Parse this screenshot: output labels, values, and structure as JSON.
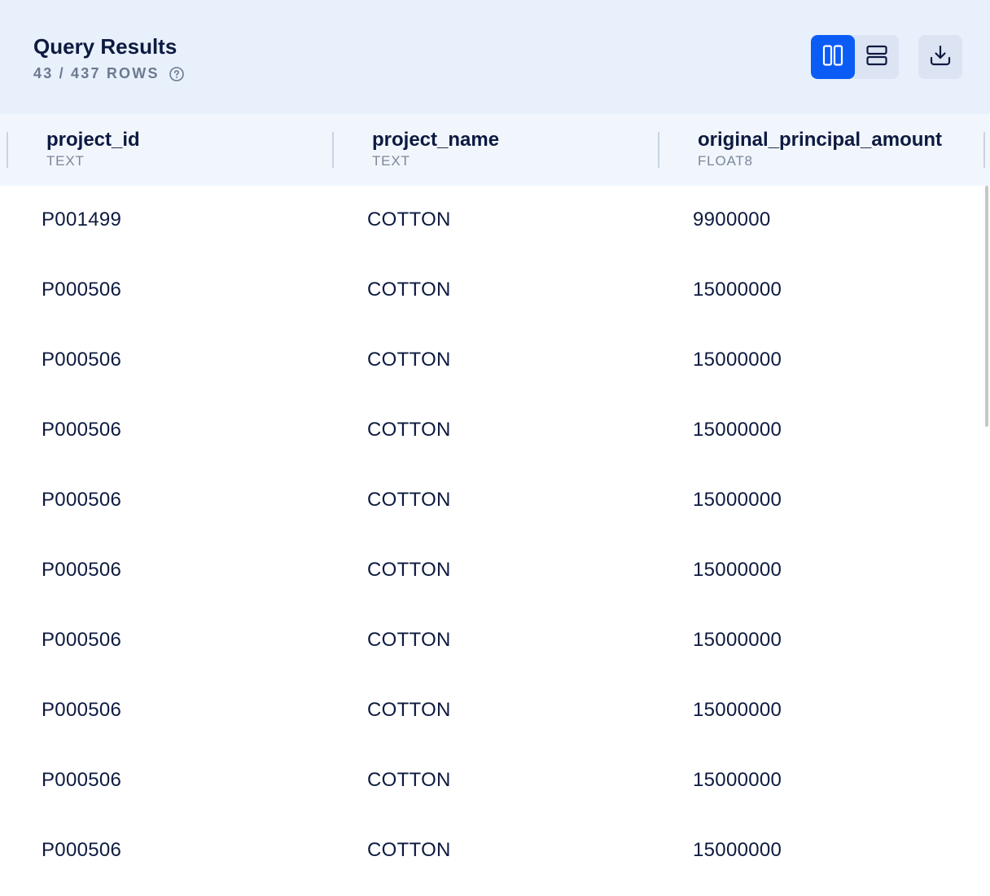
{
  "header": {
    "title": "Query Results",
    "row_count": "43 / 437 ROWS",
    "help_icon": "question-circle-icon",
    "toggle": {
      "columns_icon": "columns-layout-icon",
      "rows_icon": "rows-layout-icon",
      "active": "columns"
    },
    "download_icon": "download-icon"
  },
  "colors": {
    "accent": "#0a5cf5",
    "header_bg": "#e8f0fc",
    "column_header_bg": "#f1f6fd",
    "text": "#0d1a40",
    "muted": "#6b7a8f"
  },
  "table": {
    "columns": [
      {
        "name": "project_id",
        "type": "TEXT"
      },
      {
        "name": "project_name",
        "type": "TEXT"
      },
      {
        "name": "original_principal_amount",
        "type": "FLOAT8"
      }
    ],
    "rows": [
      [
        "P001499",
        "COTTON",
        "9900000"
      ],
      [
        "P000506",
        "COTTON",
        "15000000"
      ],
      [
        "P000506",
        "COTTON",
        "15000000"
      ],
      [
        "P000506",
        "COTTON",
        "15000000"
      ],
      [
        "P000506",
        "COTTON",
        "15000000"
      ],
      [
        "P000506",
        "COTTON",
        "15000000"
      ],
      [
        "P000506",
        "COTTON",
        "15000000"
      ],
      [
        "P000506",
        "COTTON",
        "15000000"
      ],
      [
        "P000506",
        "COTTON",
        "15000000"
      ],
      [
        "P000506",
        "COTTON",
        "15000000"
      ]
    ]
  }
}
